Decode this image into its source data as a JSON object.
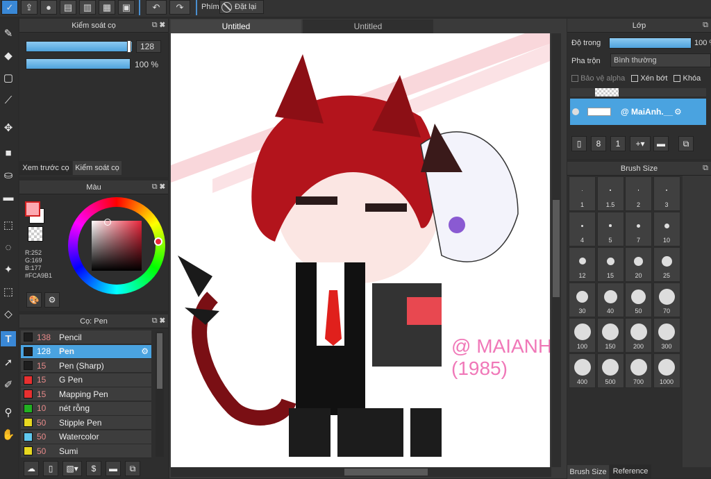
{
  "toolbar": {
    "phim": "Phím",
    "reset": "Đặt lại",
    "icons": [
      "brush-settings-icon",
      "share-icon",
      "chat-icon",
      "message-icon",
      "document-icon",
      "grid-icon",
      "add-frame-icon"
    ]
  },
  "tabs": [
    "Untitled",
    "Untitled"
  ],
  "brush_control": {
    "title": "Kiểm soát cọ",
    "size": "128",
    "opacity": "100 %",
    "size_fill": 0.98,
    "opacity_fill": 1.0
  },
  "subtabs": [
    "Xem trước cọ",
    "Kiểm soát cọ"
  ],
  "color": {
    "title": "Màu",
    "r": "R:252",
    "g": "G:169",
    "b": "B:177",
    "hex": "#FCA9B1",
    "current": "#FCA9B1"
  },
  "brush_list": {
    "title": "Cọ: Pen",
    "items": [
      {
        "size": "138",
        "name": "Pencil",
        "color": "#1e1e1e"
      },
      {
        "size": "128",
        "name": "Pen",
        "color": "#1e1e1e",
        "selected": true
      },
      {
        "size": "15",
        "name": "Pen (Sharp)",
        "color": "#1e1e1e"
      },
      {
        "size": "15",
        "name": "G Pen",
        "color": "#e83030"
      },
      {
        "size": "15",
        "name": "Mapping Pen",
        "color": "#e83030"
      },
      {
        "size": "10",
        "name": "nét rỗng",
        "color": "#22b022"
      },
      {
        "size": "50",
        "name": "Stipple Pen",
        "color": "#e8d820"
      },
      {
        "size": "50",
        "name": "Watercolor",
        "color": "#60c8ee"
      },
      {
        "size": "50",
        "name": "Sumi",
        "color": "#e8d820"
      }
    ]
  },
  "layer": {
    "title": "Lớp",
    "opacity_label": "Độ trong",
    "opacity_value": "100 %",
    "blend_label": "Pha trộn",
    "blend_value": "Bình thường",
    "alpha_protect": "Bảo vệ alpha",
    "clip": "Xén bớt",
    "lock": "Khóa",
    "layer_name": "@ MaiAnh.__"
  },
  "brush_size": {
    "title": "Brush Size",
    "sizes": [
      "1",
      "1.5",
      "2",
      "3",
      "4",
      "5",
      "7",
      "10",
      "12",
      "15",
      "20",
      "25",
      "30",
      "40",
      "50",
      "70",
      "100",
      "150",
      "200",
      "300",
      "400",
      "500",
      "700",
      "1000"
    ],
    "tabs": [
      "Brush Size",
      "Reference"
    ]
  },
  "canvas": {
    "watermark1": "@ MAIANH",
    "watermark2": "(1985)"
  }
}
